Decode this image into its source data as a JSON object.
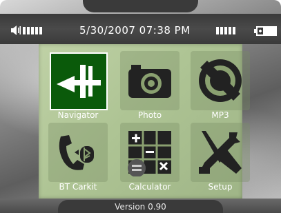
{
  "status": {
    "datetime": "5/30/2007 07:38 PM",
    "volume_bars": 5,
    "signal_bars": 5,
    "battery_level": "high"
  },
  "menu": {
    "items": [
      {
        "label": "Navigator",
        "icon": "navigator-icon",
        "selected": true
      },
      {
        "label": "Photo",
        "icon": "camera-icon",
        "selected": false
      },
      {
        "label": "MP3",
        "icon": "cd-music-icon",
        "selected": false
      },
      {
        "label": "BT Carkit",
        "icon": "bluetooth-phone-icon",
        "selected": false
      },
      {
        "label": "Calculator",
        "icon": "calculator-icon",
        "selected": false
      },
      {
        "label": "Setup",
        "icon": "tools-icon",
        "selected": false
      }
    ]
  },
  "footer": {
    "version": "Version 0.90"
  },
  "colors": {
    "screen_bg": "#aec494",
    "selected_tile": "#0a5a0a",
    "icon_dark": "#222222",
    "text": "#ffffff"
  }
}
